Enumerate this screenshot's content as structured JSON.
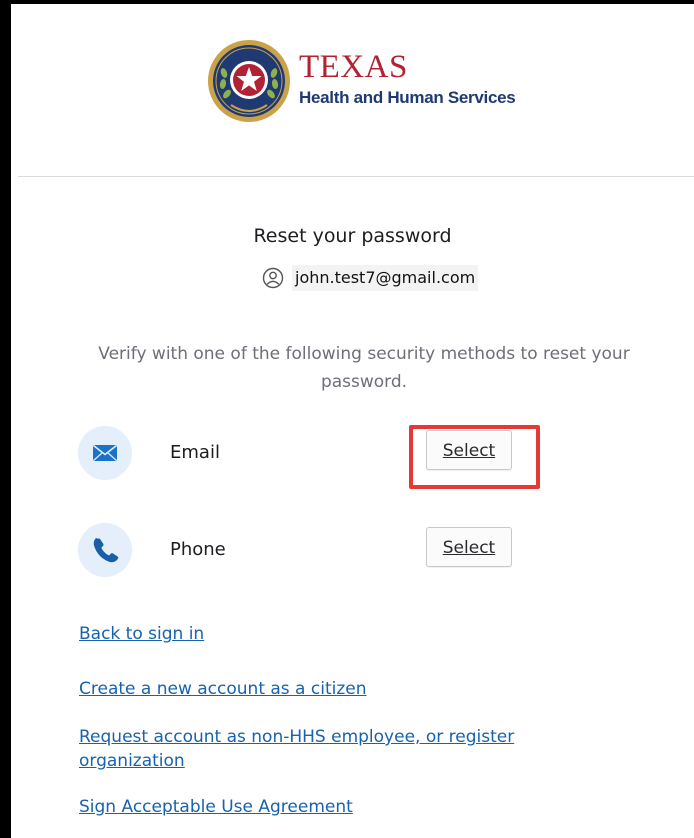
{
  "logo": {
    "title": "TEXAS",
    "subtitle": "Health and Human Services"
  },
  "page": {
    "title": "Reset your password",
    "user_email": "john.test7@gmail.com",
    "instructions": "Verify with one of the following security methods to reset your password."
  },
  "methods": [
    {
      "label": "Email",
      "icon": "mail-icon",
      "button": "Select",
      "highlighted": true
    },
    {
      "label": "Phone",
      "icon": "phone-icon",
      "button": "Select",
      "highlighted": false
    }
  ],
  "links": [
    "Back to sign in",
    "Create a new account as a citizen",
    "Request account as non-HHS employee, or register organization",
    "Sign Acceptable Use Agreement"
  ],
  "colors": {
    "link": "#1662b0",
    "highlight": "#e53935",
    "brand_red": "#b22234",
    "brand_blue": "#1f3a72",
    "icon_bg": "#e4effb"
  }
}
